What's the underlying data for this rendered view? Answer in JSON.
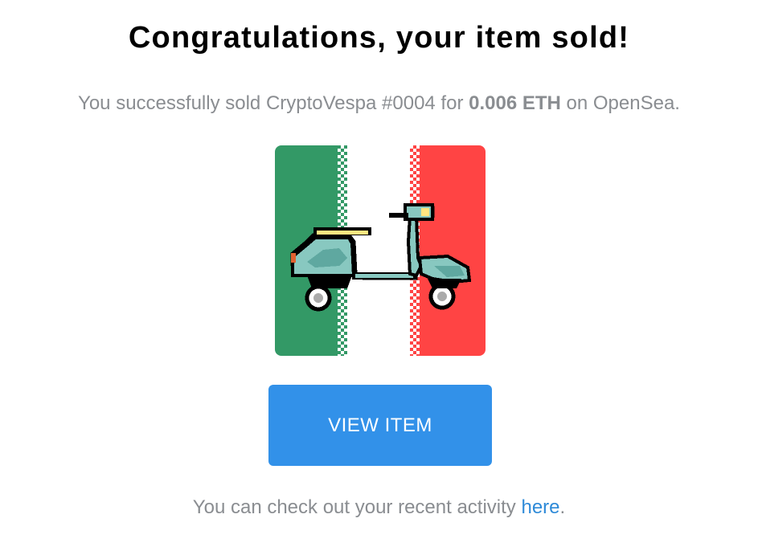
{
  "email": {
    "title": "Congratulations, your item sold!",
    "subtitle": {
      "prefix": "You successfully sold CryptoVespa #0004 for ",
      "price": "0.006 ETH",
      "suffix": " on OpenSea."
    },
    "nft_image": {
      "description_icon": "vespa-scooter-pixel-art",
      "background_colors": [
        "#339966",
        "#ffffff",
        "#ff4444"
      ]
    },
    "view_button_label": "VIEW ITEM",
    "footer": {
      "prefix": "You can check out your recent activity ",
      "link_text": "here",
      "suffix": "."
    }
  },
  "colors": {
    "button": "#3291e9",
    "link": "#2e8ad8",
    "muted_text": "#8a8d91"
  }
}
